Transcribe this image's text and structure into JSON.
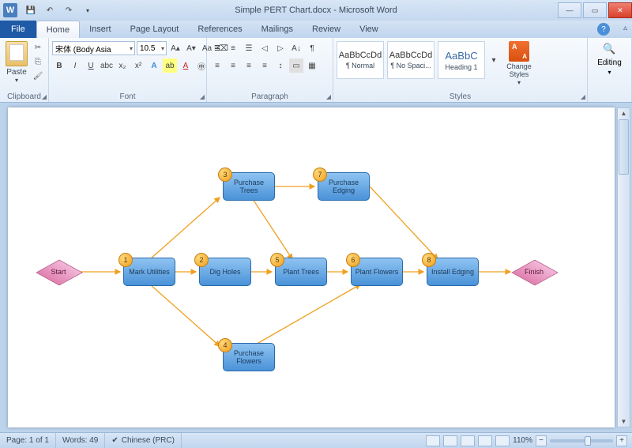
{
  "window": {
    "title": "Simple PERT Chart.docx - Microsoft Word",
    "app_letter": "W"
  },
  "tabs": {
    "file": "File",
    "items": [
      "Home",
      "Insert",
      "Page Layout",
      "References",
      "Mailings",
      "Review",
      "View"
    ],
    "active": 0
  },
  "ribbon": {
    "clipboard": {
      "label": "Clipboard",
      "paste": "Paste"
    },
    "font": {
      "label": "Font",
      "name": "宋体 (Body Asia",
      "size": "10.5"
    },
    "paragraph": {
      "label": "Paragraph"
    },
    "styles": {
      "label": "Styles",
      "items": [
        {
          "preview": "AaBbCcDd",
          "name": "¶ Normal"
        },
        {
          "preview": "AaBbCcDd",
          "name": "¶ No Spaci..."
        },
        {
          "preview": "AaBbC",
          "name": "Heading 1"
        }
      ],
      "change": "Change Styles"
    },
    "editing": {
      "label": "Editing"
    }
  },
  "chart_data": {
    "type": "diagram",
    "title": "Simple PERT Chart",
    "nodes": [
      {
        "id": "start",
        "label": "Start",
        "shape": "diamond"
      },
      {
        "id": "n1",
        "num": "1",
        "label": "Mark Utilities",
        "shape": "rect"
      },
      {
        "id": "n2",
        "num": "2",
        "label": "Dig Holes",
        "shape": "rect"
      },
      {
        "id": "n3",
        "num": "3",
        "label": "Purchase Trees",
        "shape": "rect"
      },
      {
        "id": "n4",
        "num": "4",
        "label": "Purchase Flowers",
        "shape": "rect"
      },
      {
        "id": "n5",
        "num": "5",
        "label": "Plant Trees",
        "shape": "rect"
      },
      {
        "id": "n6",
        "num": "6",
        "label": "Plant Flowers",
        "shape": "rect"
      },
      {
        "id": "n7",
        "num": "7",
        "label": "Purchase Edging",
        "shape": "rect"
      },
      {
        "id": "n8",
        "num": "8",
        "label": "Install Edging",
        "shape": "rect"
      },
      {
        "id": "finish",
        "label": "Finish",
        "shape": "diamond"
      }
    ],
    "edges": [
      [
        "start",
        "n1"
      ],
      [
        "n1",
        "n2"
      ],
      [
        "n1",
        "n3"
      ],
      [
        "n1",
        "n4"
      ],
      [
        "n2",
        "n5"
      ],
      [
        "n3",
        "n5"
      ],
      [
        "n3",
        "n7"
      ],
      [
        "n4",
        "n6"
      ],
      [
        "n5",
        "n6"
      ],
      [
        "n6",
        "n8"
      ],
      [
        "n7",
        "n8"
      ],
      [
        "n8",
        "finish"
      ]
    ]
  },
  "status": {
    "page": "Page: 1 of 1",
    "words": "Words: 49",
    "lang": "Chinese (PRC)",
    "zoom": "110%"
  }
}
